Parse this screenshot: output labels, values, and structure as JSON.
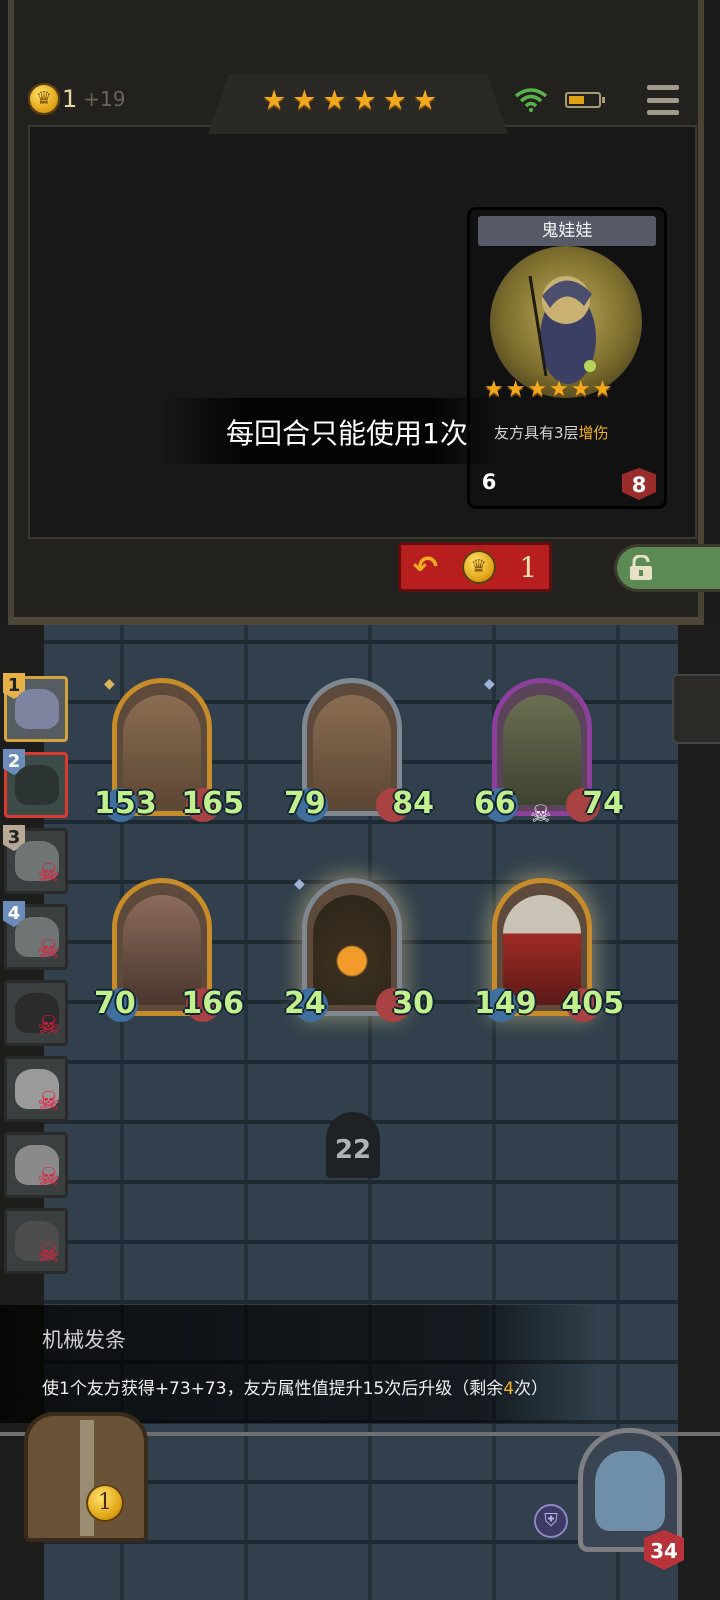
{
  "header": {
    "gold": "1",
    "gold_income": "+19",
    "tier_stars": "★★★★★★",
    "wifi_icon": "wifi-icon",
    "battery_level": 0.55,
    "menu_icon": "menu-icon"
  },
  "card": {
    "name": "鬼娃娃",
    "stars": "★★★★★★",
    "desc_prefix": "友方具有3层",
    "desc_highlight": "增伤",
    "attack": "6",
    "health": "8"
  },
  "toast": "每回合只能使用1次",
  "buttons": {
    "buyback_icon": "undo-arrow-icon",
    "buyback_cost": "1",
    "lock_icon": "lock-icon"
  },
  "opponents": [
    {
      "rank": "1",
      "state": "current"
    },
    {
      "rank": "2",
      "state": "selected"
    },
    {
      "rank": "3",
      "state": "dead"
    },
    {
      "rank": "4",
      "state": "dead"
    },
    {
      "rank": "",
      "state": "dead"
    },
    {
      "rank": "",
      "state": "dead"
    },
    {
      "rank": "",
      "state": "dead"
    },
    {
      "rank": "",
      "state": "dead"
    }
  ],
  "board": {
    "units": [
      {
        "name": "tree-golem-gold",
        "attack": "153",
        "health": "165"
      },
      {
        "name": "tree-golem-silver",
        "attack": "79",
        "health": "84"
      },
      {
        "name": "stone-golem-purple",
        "attack": "66",
        "health": "74"
      },
      {
        "name": "bald-brute",
        "attack": "70",
        "health": "166"
      },
      {
        "name": "burning-treant",
        "attack": "24",
        "health": "30"
      },
      {
        "name": "masked-knight",
        "attack": "149",
        "health": "405"
      }
    ],
    "turn": "22"
  },
  "skill": {
    "title": "机械发条",
    "body_prefix": "使1个友方获得+73+73，友方属性值提升15次后升级（剩余",
    "body_highlight": "4",
    "body_suffix": "次）"
  },
  "footer": {
    "chest_coin": "1",
    "hero_hp": "34"
  },
  "colors": {
    "accent_gold": "#f2a91c",
    "stat_green": "#c2f08c",
    "danger_red": "#b81e1e",
    "lock_green": "#5c8a55"
  }
}
